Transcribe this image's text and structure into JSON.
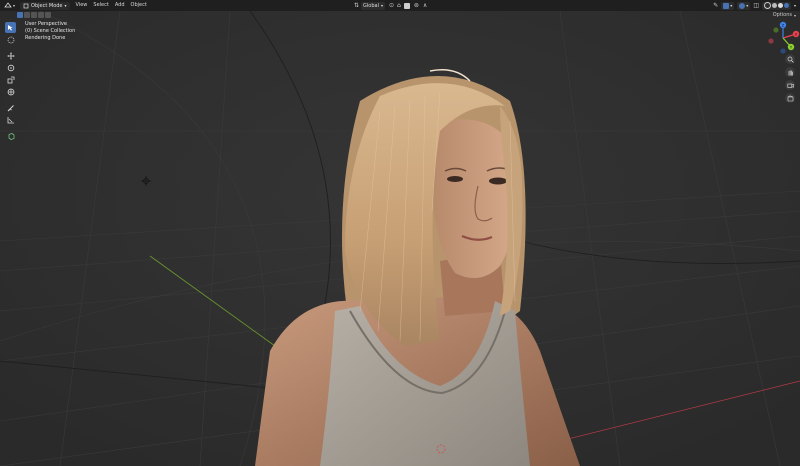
{
  "header": {
    "editor_type_icon": "view3d-icon",
    "mode_label": "Object Mode",
    "menus": [
      "View",
      "Select",
      "Add",
      "Object"
    ],
    "transform_orientation": "Global",
    "options_label": "Options"
  },
  "overlay": {
    "view_name": "User Perspective",
    "collection": "(0) Scene Collection",
    "status": "Rendering Done"
  },
  "toolbar": {
    "tools": [
      "select-box-icon",
      "cursor-icon",
      "move-icon",
      "rotate-icon",
      "scale-icon",
      "transform-icon",
      "annotate-icon",
      "measure-icon",
      "add-cube-icon"
    ]
  },
  "gizmo": {
    "axes": [
      "X",
      "Y",
      "Z"
    ],
    "colors": {
      "x": "#e8434f",
      "y": "#8bcf33",
      "z": "#3d82e6"
    }
  },
  "colors": {
    "header_bg": "#1f1f1f",
    "viewport_bg": "#2f2f2f",
    "active_tool": "#4772b3",
    "x_axis": "#b33a48",
    "y_axis": "#6b9a2e"
  }
}
